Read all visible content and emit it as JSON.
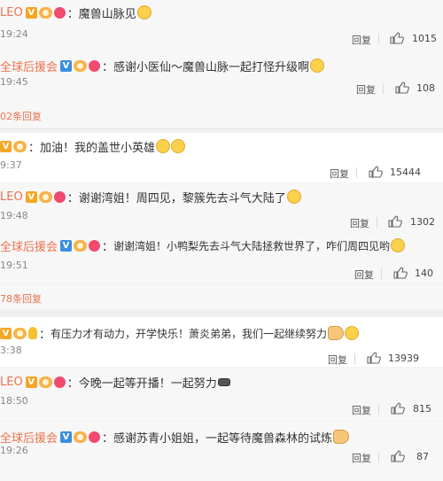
{
  "comments": [
    {
      "user": "LEO",
      "badge": "V",
      "text": "魔兽山脉见",
      "time": "19:24",
      "reply": "回复",
      "likes": "1015"
    },
    {
      "user": "全球后援会",
      "badge": "V",
      "text": "感谢小医仙～魔兽山脉一起打怪升级啊",
      "time": "19:45",
      "reply": "回复",
      "likes": "108"
    },
    {
      "more": "02条回复"
    },
    {
      "user": "",
      "badge": "V",
      "text": "加油！我的盖世小英雄",
      "time": "9:37",
      "reply": "回复",
      "likes": "15444"
    },
    {
      "user": "LEO",
      "badge": "V",
      "text": "谢谢湾姐！周四见，黎簇先去斗气大陆了",
      "time": "19:48",
      "reply": "回复",
      "likes": "1302"
    },
    {
      "user": "全球后援会",
      "badge": "V",
      "text": "谢谢湾姐！小鸭梨先去斗气大陆拯救世界了，咋们周四见哟",
      "time": "19:51",
      "reply": "回复",
      "likes": "140"
    },
    {
      "more": "78条回复"
    },
    {
      "user": "",
      "badge": "V",
      "text": "有压力才有动力，开学快乐！萧炎弟弟，我们一起继续努力",
      "time": "3:38",
      "reply": "回复",
      "likes": "13939"
    },
    {
      "user": "LEO",
      "badge": "V",
      "text": "今晚一起等开播！一起努力",
      "time": "18:50",
      "reply": "回复",
      "likes": "815"
    },
    {
      "user": "全球后援会",
      "badge": "V",
      "text": "感谢苏青小姐姐，一起等待魔兽森林的试炼",
      "time": "19:26",
      "reply": "回复",
      "likes": "87"
    }
  ],
  "colors": {
    "username": "#eb7350",
    "vip_badge": "#f5a623",
    "blue_badge": "#3b8fe0",
    "text": "#333333"
  },
  "icons": {
    "like": "thumbs-up-icon"
  }
}
